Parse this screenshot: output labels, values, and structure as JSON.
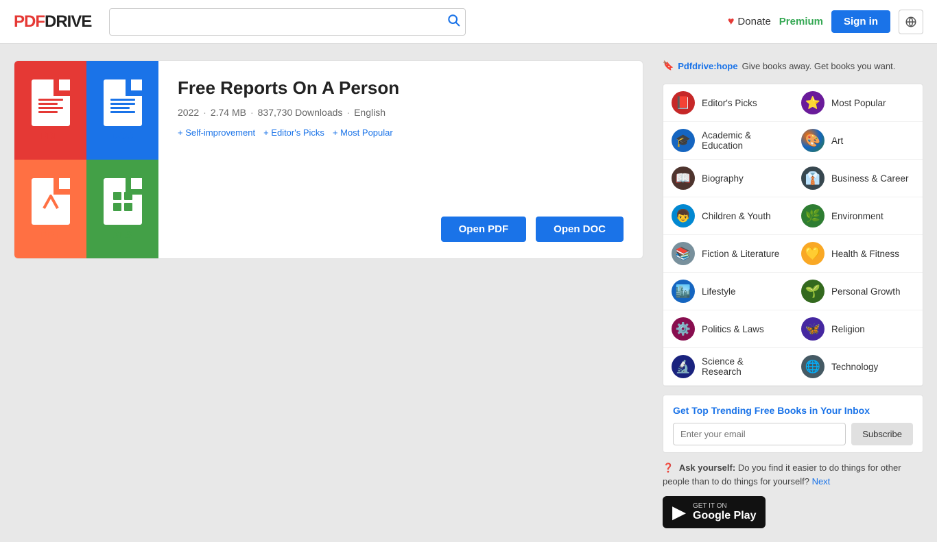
{
  "header": {
    "logo_pdf": "PDF",
    "logo_drive": "DRIVE",
    "search_placeholder": "",
    "donate_label": "Donate",
    "premium_label": "Premium",
    "signin_label": "Sign in"
  },
  "book": {
    "title": "Free Reports On A Person",
    "year": "2022",
    "size": "2.74 MB",
    "downloads": "837,730 Downloads",
    "language": "English",
    "tags": [
      {
        "label": "+ Self-improvement"
      },
      {
        "label": "+ Editor's Picks"
      },
      {
        "label": "+ Most Popular"
      }
    ],
    "btn_pdf": "Open PDF",
    "btn_doc": "Open DOC",
    "formats": [
      "PDF",
      "DOC",
      "PPT",
      "XLS"
    ]
  },
  "sidebar": {
    "hope_prefix": "🔖",
    "hope_link": "Pdfdrive:hope",
    "hope_text": "Give books away. Get books you want.",
    "categories": [
      {
        "id": "editors",
        "label": "Editor's Picks",
        "icon": "📕",
        "color": "#c62828"
      },
      {
        "id": "popular",
        "label": "Most Popular",
        "icon": "⭐",
        "color": "#6a1b9a"
      },
      {
        "id": "academic",
        "label": "Academic & Education",
        "icon": "🎓",
        "color": "#1565c0"
      },
      {
        "id": "art",
        "label": "Art",
        "icon": "🎨",
        "color": "#e65100"
      },
      {
        "id": "biography",
        "label": "Biography",
        "icon": "📖",
        "color": "#4e342e"
      },
      {
        "id": "business",
        "label": "Business & Career",
        "icon": "👔",
        "color": "#37474f"
      },
      {
        "id": "children",
        "label": "Children & Youth",
        "icon": "👦",
        "color": "#0288d1"
      },
      {
        "id": "environment",
        "label": "Environment",
        "icon": "🌿",
        "color": "#2e7d32"
      },
      {
        "id": "fiction",
        "label": "Fiction & Literature",
        "icon": "📚",
        "color": "#78909c"
      },
      {
        "id": "health",
        "label": "Health & Fitness",
        "icon": "💛",
        "color": "#f9a825"
      },
      {
        "id": "lifestyle",
        "label": "Lifestyle",
        "icon": "🏙️",
        "color": "#1565c0"
      },
      {
        "id": "personal",
        "label": "Personal Growth",
        "icon": "🌱",
        "color": "#33691e"
      },
      {
        "id": "politics",
        "label": "Politics & Laws",
        "icon": "⚙️",
        "color": "#880e4f"
      },
      {
        "id": "religion",
        "label": "Religion",
        "icon": "🦋",
        "color": "#4527a0"
      },
      {
        "id": "science",
        "label": "Science & Research",
        "icon": "🔬",
        "color": "#1a237e"
      },
      {
        "id": "technology",
        "label": "Technology",
        "icon": "🌐",
        "color": "#455a64"
      }
    ],
    "subscribe_title": "Get Top Trending Free Books in Your Inbox",
    "email_placeholder": "Enter your email",
    "subscribe_btn": "Subscribe",
    "ask_label": "Ask yourself:",
    "ask_text": " Do you find it easier to do things for other people than to do things for yourself?",
    "ask_link": "Next",
    "gplay_small": "GET IT ON",
    "gplay_big": "Google Play"
  }
}
